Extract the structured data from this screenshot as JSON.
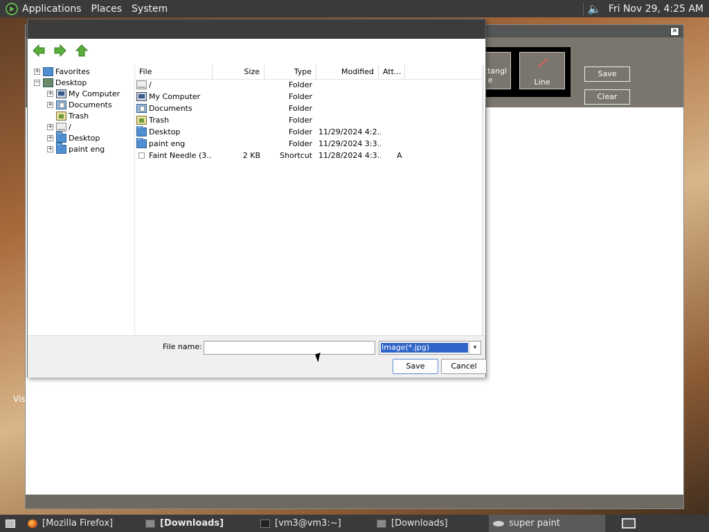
{
  "top_panel": {
    "menus": [
      "Applications",
      "Places",
      "System"
    ],
    "clock": "Fri Nov 29,  4:25 AM",
    "icons": [
      "distro-logo-icon",
      "speaker-icon"
    ]
  },
  "paint_app": {
    "close_label": "×",
    "tool_rect_label": "Rectangl e",
    "tool_line_label": "Line",
    "save_label": "Save",
    "clear_label": "Clear",
    "side_text": "Vis"
  },
  "dialog": {
    "tree": [
      {
        "label": "Favorites",
        "expander": "+",
        "icon": "folder-icon"
      },
      {
        "label": "Desktop",
        "expander": "−",
        "icon": "desktop-icon"
      },
      {
        "label": "My Computer",
        "expander": "+",
        "icon": "computer-icon"
      },
      {
        "label": "Documents",
        "expander": "+",
        "icon": "documents-icon"
      },
      {
        "label": "Trash",
        "expander": "",
        "icon": "trash-icon"
      },
      {
        "label": "/",
        "expander": "+",
        "icon": "drive-icon"
      },
      {
        "label": "Desktop",
        "expander": "+",
        "icon": "folder-icon"
      },
      {
        "label": "paint eng",
        "expander": "+",
        "icon": "folder-icon"
      }
    ],
    "columns": {
      "file": "File",
      "size": "Size",
      "type": "Type",
      "modified": "Modified",
      "att": "Att..."
    },
    "rows": [
      {
        "name": "/",
        "size": "",
        "type": "Folder",
        "modified": "",
        "att": "",
        "icon": "drive-icon"
      },
      {
        "name": "My Computer",
        "size": "",
        "type": "Folder",
        "modified": "",
        "att": "",
        "icon": "computer-icon"
      },
      {
        "name": "Documents",
        "size": "",
        "type": "Folder",
        "modified": "",
        "att": "",
        "icon": "documents-icon"
      },
      {
        "name": "Trash",
        "size": "",
        "type": "Folder",
        "modified": "",
        "att": "",
        "icon": "trash-icon"
      },
      {
        "name": "Desktop",
        "size": "",
        "type": "Folder",
        "modified": "11/29/2024 4:2...",
        "att": "",
        "icon": "folder-icon"
      },
      {
        "name": "paint eng",
        "size": "",
        "type": "Folder",
        "modified": "11/29/2024 3:3...",
        "att": "",
        "icon": "folder-icon"
      },
      {
        "name": "Faint Needle (3...",
        "size": "2 KB",
        "type": "Shortcut",
        "modified": "11/28/2024 4:3...",
        "att": "A",
        "icon": "shortcut-icon"
      }
    ],
    "filename_label": "File name:",
    "filename_value": "",
    "filetype_value": "Image(*.jpg)",
    "save_label": "Save",
    "cancel_label": "Cancel",
    "nav_icons": [
      "back-arrow-icon",
      "forward-arrow-icon",
      "up-arrow-icon"
    ]
  },
  "taskbar": {
    "tasks": [
      {
        "label": "[Mozilla Firefox]",
        "icon": "firefox-icon"
      },
      {
        "label": "[Downloads]",
        "icon": "folder-icon"
      },
      {
        "label": "[vm3@vm3:~]",
        "icon": "terminal-icon"
      },
      {
        "label": "[Downloads]",
        "icon": "folder-icon"
      },
      {
        "label": "super paint",
        "icon": "paint-icon"
      }
    ]
  },
  "colors": {
    "panel": "#3a3a3a",
    "nav_arrow": "#5cae3c",
    "selection": "#2f64c8",
    "paint_toolbar": "#7a756d"
  }
}
